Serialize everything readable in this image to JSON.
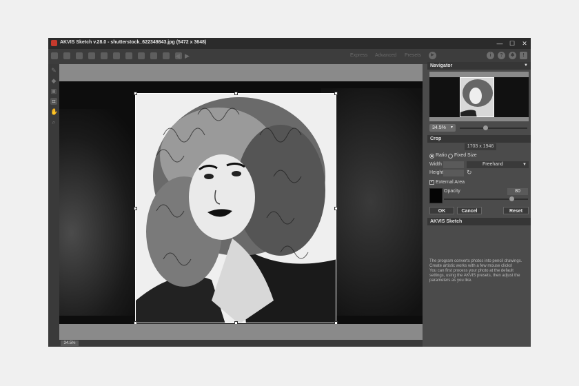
{
  "window": {
    "title": "AKVIS Sketch v.28.0 - shutterstock_622349843.jpg (5472 x 3648)",
    "minimize_glyph": "—",
    "maximize_glyph": "☐",
    "close_glyph": "✕"
  },
  "toolbar": {
    "icons": [
      "home-icon",
      "open-icon",
      "save-icon",
      "print-icon",
      "share-icon",
      "batch-icon",
      "image-icon",
      "preferences-icon",
      "adjust-icon",
      "effects-icon",
      "check-icon",
      "undo-icon",
      "redo-icon"
    ],
    "modes": [
      "Express",
      "Advanced",
      "Presets"
    ],
    "right_icons": [
      "about-icon",
      "help-icon",
      "settings-icon",
      "tips-icon"
    ]
  },
  "left_tools": [
    "pencil-icon",
    "eraser-icon",
    "stamp-icon",
    "crop-icon",
    "hand-icon",
    "zoom-icon"
  ],
  "status": {
    "zoom": "34.5%"
  },
  "navigator": {
    "title": "Navigator",
    "zoom": "34.5%",
    "zoom_level": 0.38
  },
  "crop": {
    "title": "Crop",
    "size": "1703 x 1946",
    "ratio_label": "Ratio",
    "fixed_label": "Fixed Size",
    "selected_mode": "ratio",
    "width_label": "Width",
    "height_label": "Height",
    "ratio_value": "Freehand",
    "external_area_label": "External Area",
    "external_area_checked": true,
    "opacity_label": "Opacity",
    "opacity_value": "80",
    "opacity_level": 0.8,
    "ok_label": "OK",
    "cancel_label": "Cancel",
    "reset_label": "Reset"
  },
  "help": {
    "title": "AKVIS Sketch",
    "text": "The program converts photos into pencil drawings.\nCreate artistic works with a few mouse clicks!\nYou can first process your photo at the default\nsettings, using the AKVIS presets, then adjust the\nparameters as you like."
  }
}
